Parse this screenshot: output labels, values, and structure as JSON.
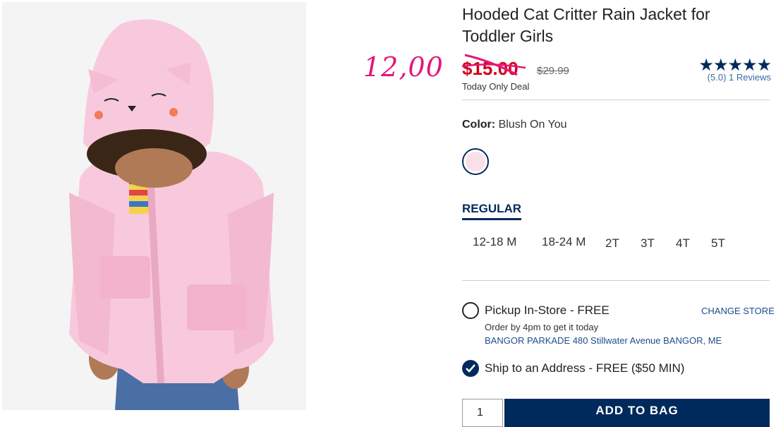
{
  "product": {
    "title": "Hooded Cat Critter Rain Jacket for Toddler Girls",
    "sale_price": "$15.00",
    "regular_price": "$29.99",
    "deal_label": "Today Only Deal",
    "annotation_price": "12,00",
    "rating": {
      "stars": "★★★★★",
      "score_text": "(5.0)",
      "reviews_text": "1 Reviews",
      "value": 5
    },
    "color": {
      "label": "Color:",
      "value": "Blush On You",
      "swatch_color": "#f9dfe8"
    },
    "fit_tab": "REGULAR",
    "sizes": [
      "12-18 M",
      "18-24 M",
      "2T",
      "3T",
      "4T",
      "5T"
    ]
  },
  "fulfillment": {
    "pickup_label": "Pickup In-Store - FREE",
    "change_store": "CHANGE STORE",
    "pickup_sub": "Order by 4pm to get it today",
    "store": "BANGOR PARKADE 480 Stillwater Avenue  BANGOR, ME",
    "ship_label": "Ship to an Address - FREE ($50 MIN)"
  },
  "cart": {
    "quantity": "1",
    "add_to_bag": "ADD TO BAG"
  },
  "colors": {
    "brand_navy": "#002a5c",
    "sale_red": "#d0021b",
    "annotation_pink": "#e5157a",
    "link_blue": "#1f4d8c"
  }
}
